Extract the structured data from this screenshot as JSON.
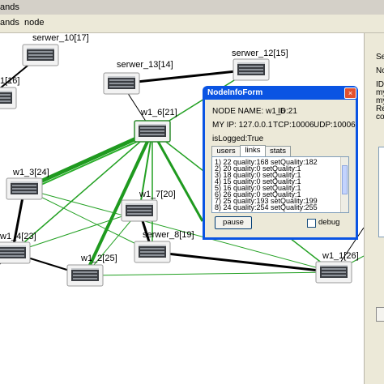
{
  "topbar": {
    "fragment": "ands",
    "menu": "node"
  },
  "graph": {
    "nodes": [
      {
        "id": "serwer_10",
        "label": "serwer_10[17]"
      },
      {
        "id": "serwer_12",
        "label": "serwer_12[15]"
      },
      {
        "id": "serwer_13",
        "label": "serwer_13[14]"
      },
      {
        "id": "left_16",
        "label": "1[16]"
      },
      {
        "id": "w1_6",
        "label": "w1_6[21]"
      },
      {
        "id": "w1_3",
        "label": "w1_3[24]"
      },
      {
        "id": "w1_7",
        "label": "w1_7[20]"
      },
      {
        "id": "w1_4",
        "label": "w1_4[23]"
      },
      {
        "id": "serwer_8",
        "label": "serwer_8[19]"
      },
      {
        "id": "w1_2",
        "label": "w1_2[25]"
      },
      {
        "id": "w1_1",
        "label": "w1_1[26]"
      }
    ]
  },
  "sidepanel": {
    "lines": [
      "Se",
      "No",
      "ID",
      "my",
      "my",
      "Re",
      "co"
    ]
  },
  "node_form": {
    "title": "NodeInfoForm",
    "close_glyph": "×",
    "node_name": "NODE NAME: w1_6",
    "node_id": "ID:21",
    "my_ip": "MY IP: 127.0.0.1",
    "tcp": "TCP:10006",
    "udp": "UDP:10006",
    "is_logged": "isLogged:",
    "is_logged_value": "True",
    "tabs": [
      "users",
      "links",
      "stats"
    ],
    "active_tab": "links",
    "links": [
      "1)  22 quality:168  setQuality:182",
      "2)  20 quality:0  setQuality:1",
      "3)  18 quality:0  setQuality:1",
      "4)  15 quality:0  setQuality:1",
      "5)  16 quality:0  setQuality:1",
      "6)  26 quality:0  setQuality:1",
      "7)  25 quality:193  setQuality:199",
      "8)  24 quality:254  setQuality:255"
    ],
    "pause_label": "pause",
    "debug_label": "debug",
    "debug_checked": false
  }
}
